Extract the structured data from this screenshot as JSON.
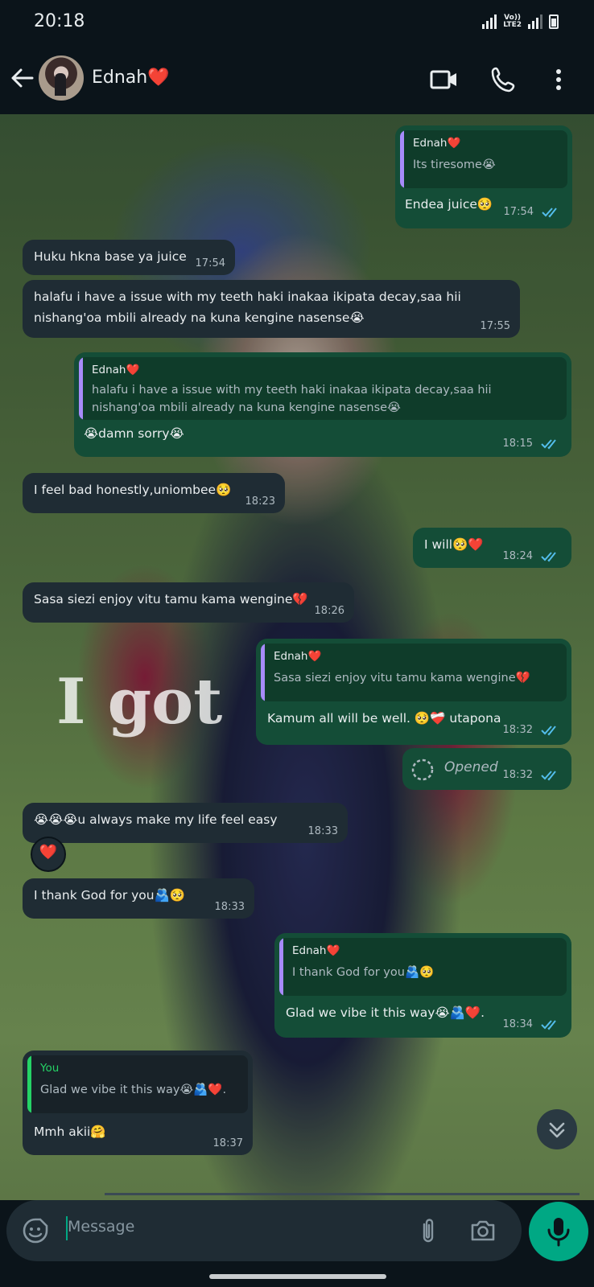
{
  "status": {
    "time": "20:18",
    "network_label": "LTE2",
    "volte_label": "Vo))"
  },
  "header": {
    "contact_name": "Ednah❤️"
  },
  "background_text": "I got",
  "messages": [
    {
      "dir": "out",
      "quote_name": "Ednah❤️",
      "quote_text": "Its tiresome😭",
      "text": "Endea juice🥺",
      "time": "17:54",
      "ticks": "read"
    },
    {
      "dir": "in",
      "text": "Huku hkna base ya juice",
      "time": "17:54"
    },
    {
      "dir": "in",
      "text": "halafu i have a issue with my teeth haki inakaa ikipata decay,saa hii nishang'oa mbili already na kuna kengine nasense😭",
      "time": "17:55"
    },
    {
      "dir": "out",
      "quote_name": "Ednah❤️",
      "quote_text": "halafu i have a issue with my teeth haki inakaa ikipata decay,saa hii nishang'oa mbili already na kuna kengine nasense😭",
      "text": "😭damn sorry😭",
      "time": "18:15",
      "ticks": "read"
    },
    {
      "dir": "in",
      "text": "I feel bad honestly,uniombee🥺",
      "time": "18:23"
    },
    {
      "dir": "out",
      "text": "I will🥺❤️",
      "time": "18:24",
      "ticks": "read"
    },
    {
      "dir": "in",
      "text": "Sasa siezi enjoy vitu tamu kama wengine💔",
      "time": "18:26"
    },
    {
      "dir": "out",
      "quote_name": "Ednah❤️",
      "quote_text": "Sasa siezi enjoy vitu tamu kama wengine💔",
      "text": "Kamum all will be well. 🥺❤️‍🩹 utapona",
      "time": "18:32",
      "ticks": "read"
    },
    {
      "dir": "out",
      "text": "Opened",
      "time": "18:32",
      "ticks": "read",
      "view_once": true
    },
    {
      "dir": "in",
      "text": "😭😭😭u always make my life feel easy",
      "time": "18:33",
      "reaction": "❤️"
    },
    {
      "dir": "in",
      "text": "I thank God for you🫂🥺",
      "time": "18:33"
    },
    {
      "dir": "out",
      "quote_name": "Ednah❤️",
      "quote_text": "I thank God for you🫂🥺",
      "text": "Glad we vibe it this way😭🫂❤️.",
      "time": "18:34",
      "ticks": "read"
    },
    {
      "dir": "in",
      "quote_name": "You",
      "quote_text": "Glad we vibe it this way😭🫂❤️.",
      "text": "Mmh akii🤗",
      "time": "18:37"
    }
  ],
  "input": {
    "placeholder": "Message"
  },
  "colors": {
    "incoming_bubble": "#1f2c34",
    "outgoing_bubble": "#144d37",
    "read_tick": "#53bdeb",
    "accent": "#00a884",
    "quote_bar_contact": "#a78bfa",
    "quote_bar_you": "#25d366"
  }
}
